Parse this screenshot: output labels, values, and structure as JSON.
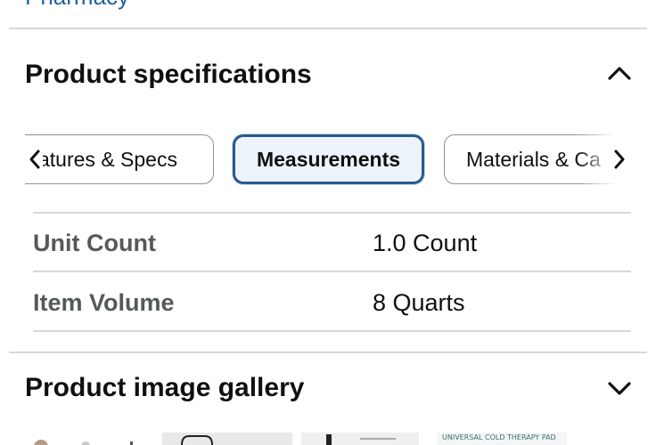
{
  "prev_section": {
    "link_text": "Pharmacy"
  },
  "product_specifications": {
    "title": "Product specifications",
    "expanded": true,
    "tabs": [
      {
        "label": "Features & Specs",
        "visible_label": "atures & Specs",
        "active": false
      },
      {
        "label": "Measurements",
        "active": true
      },
      {
        "label": "Materials & Care",
        "visible_label": "Materials & Ca",
        "active": false
      }
    ],
    "rows": [
      {
        "label": "Unit Count",
        "value": "1.0 Count"
      },
      {
        "label": "Item Volume",
        "value": "8 Quarts"
      }
    ]
  },
  "product_image_gallery": {
    "title": "Product image gallery",
    "expanded": false,
    "thumbnail_caption": "UNIVERSAL COLD THERAPY PAD"
  },
  "colors": {
    "link": "#2162a1",
    "active_tab_border": "#2b5a8e",
    "active_tab_bg": "#edf3fb",
    "label_gray": "#565959",
    "divider": "#d5d9d9"
  },
  "icons": {
    "collapse": "chevron-up-icon",
    "expand": "chevron-down-icon",
    "scroll_left": "chevron-left-icon",
    "scroll_right": "chevron-right-icon"
  }
}
